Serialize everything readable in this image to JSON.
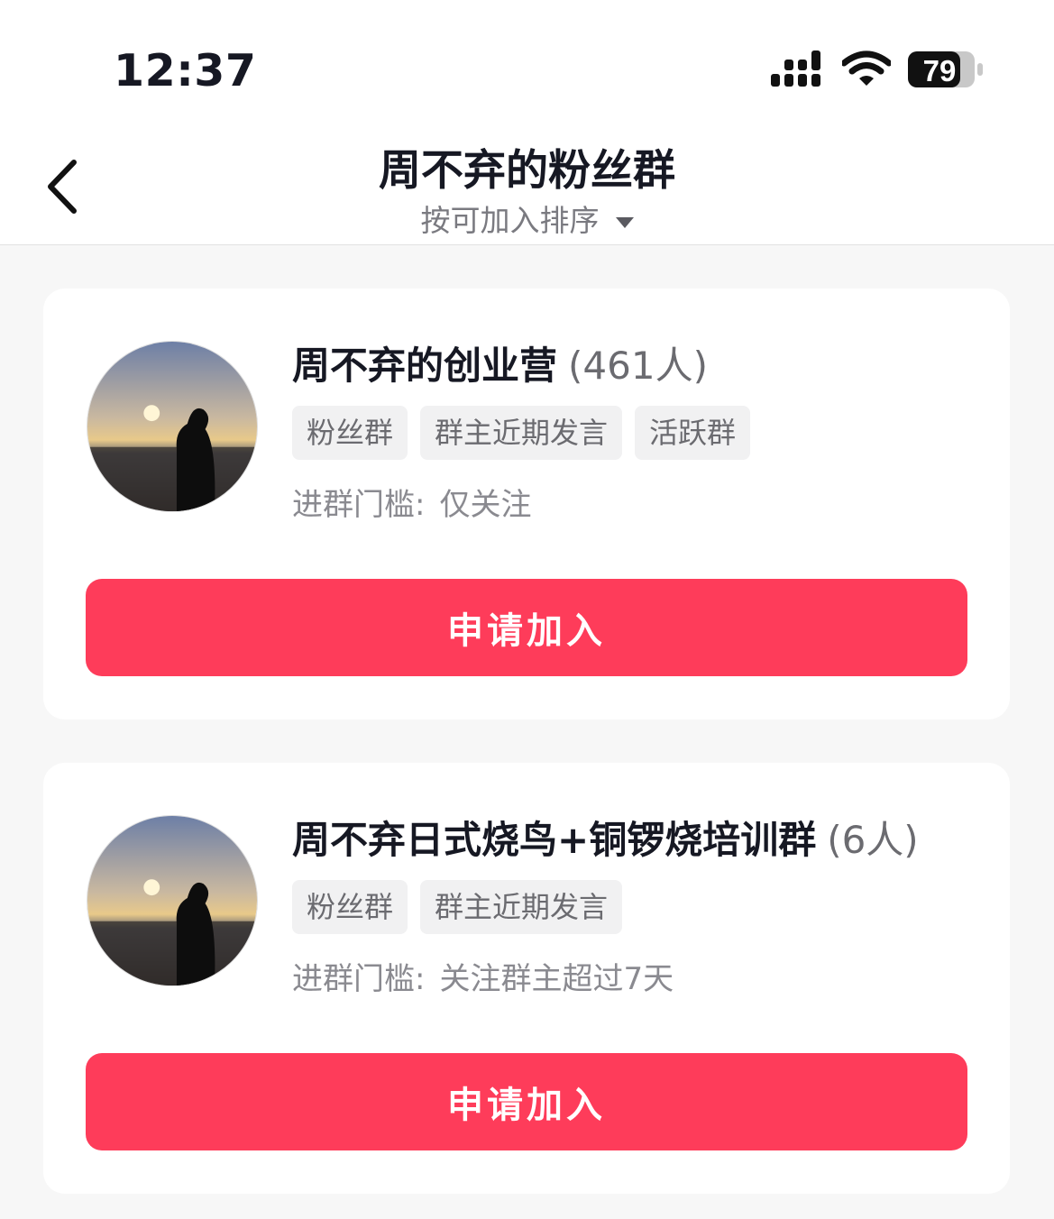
{
  "status_bar": {
    "time": "12:37",
    "battery": "79"
  },
  "nav": {
    "title": "周不弃的粉丝群",
    "sort_label": "按可加入排序"
  },
  "groups": [
    {
      "name": "周不弃的创业营",
      "count": "(461人)",
      "tags": [
        "粉丝群",
        "群主近期发言",
        "活跃群"
      ],
      "threshold_label": "进群门槛:",
      "threshold_value": "仅关注",
      "button": "申请加入"
    },
    {
      "name": "周不弃日式烧鸟+铜锣烧培训群",
      "count": "(6人)",
      "tags": [
        "粉丝群",
        "群主近期发言"
      ],
      "threshold_label": "进群门槛:",
      "threshold_value": "关注群主超过7天",
      "button": "申请加入"
    }
  ],
  "colors": {
    "accent": "#fe3c5a",
    "background": "#f7f7f7"
  },
  "icons": [
    "back-arrow-icon",
    "signal-icon",
    "wifi-icon",
    "battery-icon",
    "dropdown-arrow-icon"
  ]
}
